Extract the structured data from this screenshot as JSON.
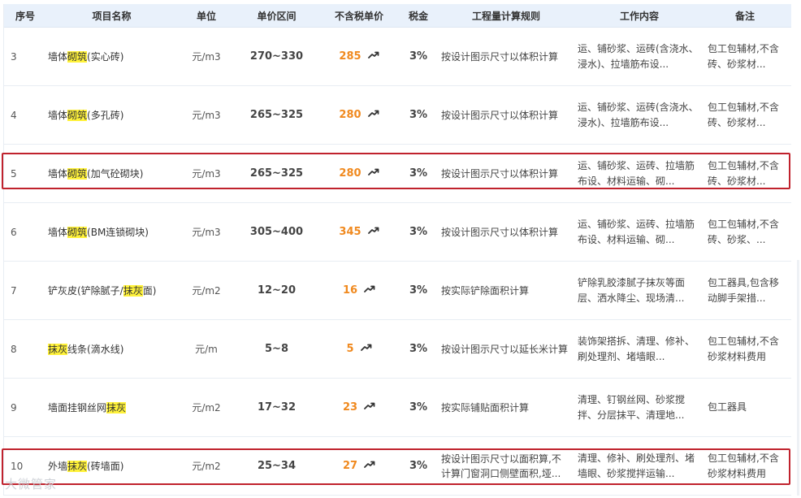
{
  "headers": {
    "seq": "序号",
    "name": "项目名称",
    "unit": "单位",
    "range": "单价区间",
    "price": "不含税单价",
    "tax": "税金",
    "rule": "工程量计算规则",
    "work": "工作内容",
    "note": "备注"
  },
  "rows": [
    {
      "seq": "3",
      "name_pre": "墙体",
      "name_hl": "砌筑",
      "name_post": "(实心砖)",
      "unit": "元/m3",
      "range": "270~330",
      "price": "285",
      "tax": "3%",
      "rule": "按设计图示尺寸以体积计算",
      "work": "运、铺砂浆、运砖(含浇水、浸水)、拉墙筋布设...",
      "note": "包工包辅材,不含砖、砂浆材..."
    },
    {
      "seq": "4",
      "name_pre": "墙体",
      "name_hl": "砌筑",
      "name_post": "(多孔砖)",
      "unit": "元/m3",
      "range": "265~325",
      "price": "280",
      "tax": "3%",
      "rule": "按设计图示尺寸以体积计算",
      "work": "运、铺砂浆、运砖(含浇水、浸水)、拉墙筋布设...",
      "note": "包工包辅材,不含砖、砂浆材..."
    },
    {
      "seq": "5",
      "name_pre": "墙体",
      "name_hl": "砌筑",
      "name_post": "(加气砼砌块)",
      "unit": "元/m3",
      "range": "265~325",
      "price": "280",
      "tax": "3%",
      "rule": "按设计图示尺寸以体积计算",
      "work": "运、铺砂浆、运砖、拉墙筋布设、材料运输、砌...",
      "note": "包工包辅材,不含砖、砂浆材..."
    },
    {
      "seq": "6",
      "name_pre": "墙体",
      "name_hl": "砌筑",
      "name_post": "(BM连锁砌块)",
      "unit": "元/m3",
      "range": "305~400",
      "price": "345",
      "tax": "3%",
      "rule": "按设计图示尺寸以体积计算",
      "work": "运、铺砂浆、运砖、拉墙筋布设、材料运输、砌...",
      "note": "包工包辅材,不含砖、砂浆、..."
    },
    {
      "seq": "7",
      "name_pre": "铲灰皮(铲除腻子/",
      "name_hl": "抹灰",
      "name_post": "面)",
      "unit": "元/m2",
      "range": "12~20",
      "price": "16",
      "tax": "3%",
      "rule": "按实际铲除面积计算",
      "work": "铲除乳胶漆腻子抹灰等面层、洒水降尘、现场清...",
      "note": "包工器具,包含移动脚手架措..."
    },
    {
      "seq": "8",
      "name_pre": "",
      "name_hl": "抹灰",
      "name_post": "线条(滴水线)",
      "unit": "元/m",
      "range": "5~8",
      "price": "5",
      "tax": "3%",
      "rule": "按设计图示尺寸以延长米计算",
      "work": "装饰架搭拆、清理、修补、刷处理剂、堵墙眼...",
      "note": "包工包辅材,不含砂浆材料费用"
    },
    {
      "seq": "9",
      "name_pre": "墙面挂钢丝网",
      "name_hl": "抹灰",
      "name_post": "",
      "unit": "元/m2",
      "range": "17~32",
      "price": "23",
      "tax": "3%",
      "rule": "按实际铺贴面积计算",
      "work": "清理、钉钢丝网、砂浆搅拌、分层抹平、清理地...",
      "note": "包工器具"
    },
    {
      "seq": "10",
      "name_pre": "外墙",
      "name_hl": "抹灰",
      "name_post": "(砖墙面)",
      "unit": "元/m2",
      "range": "25~34",
      "price": "27",
      "tax": "3%",
      "rule": "按设计图示尺寸以面积算,不计算门窗洞口侧壁面积,垭...",
      "work": "清理、修补、刷处理剂、堵墙眼、砂浆搅拌运输...",
      "note": "包工包辅材,不含砂浆材料费用"
    }
  ],
  "highlight_color": "#fff23a",
  "price_color": "#f0891e",
  "frame_color": "#c0222d",
  "watermark": "大微管家"
}
